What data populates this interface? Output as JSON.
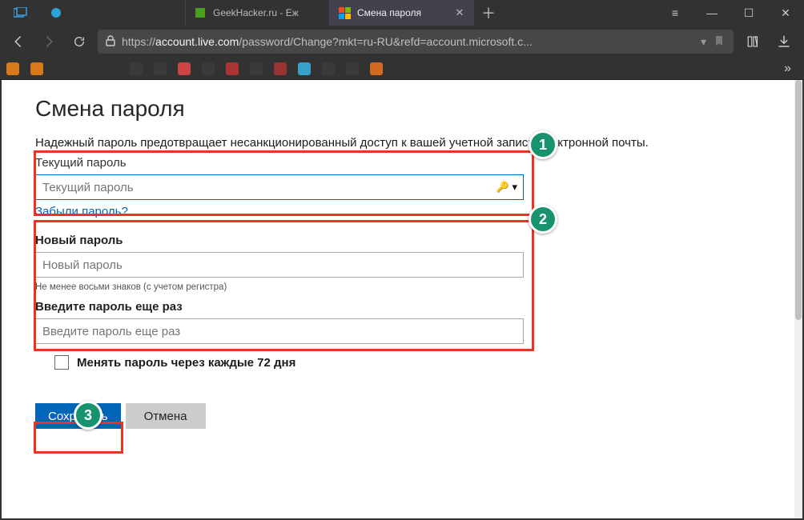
{
  "browser": {
    "tabs": [
      {
        "label": "",
        "favicon_color": "#2aa3d8"
      },
      {
        "label": "GeekHacker.ru - Еж",
        "favicon_color": "#4b9e1e"
      },
      {
        "label": "Смена пароля",
        "active": true,
        "favicon": "microsoft"
      }
    ],
    "url_prefix": "https://",
    "url_host": "account.live.com",
    "url_path": "/password/Change?mkt=ru-RU&refd=account.microsoft.c..."
  },
  "page": {
    "heading": "Смена пароля",
    "subtitle": "Надежный пароль предотвращает несанкционированный доступ к вашей учетной записи электронной почты.",
    "current_label": "Текущий пароль",
    "current_placeholder": "Текущий пароль",
    "forgot_link": "Забыли пароль?",
    "new_label": "Новый пароль",
    "new_placeholder": "Новый пароль",
    "hint": "Не менее восьми знаков (с учетом регистра)",
    "confirm_label": "Введите пароль еще раз",
    "confirm_placeholder": "Введите пароль еще раз",
    "checkbox_label": "Менять пароль через каждые 72 дня",
    "save_label": "Сохранить",
    "cancel_label": "Отмена"
  },
  "annotations": {
    "b1": "1",
    "b2": "2",
    "b3": "3"
  }
}
